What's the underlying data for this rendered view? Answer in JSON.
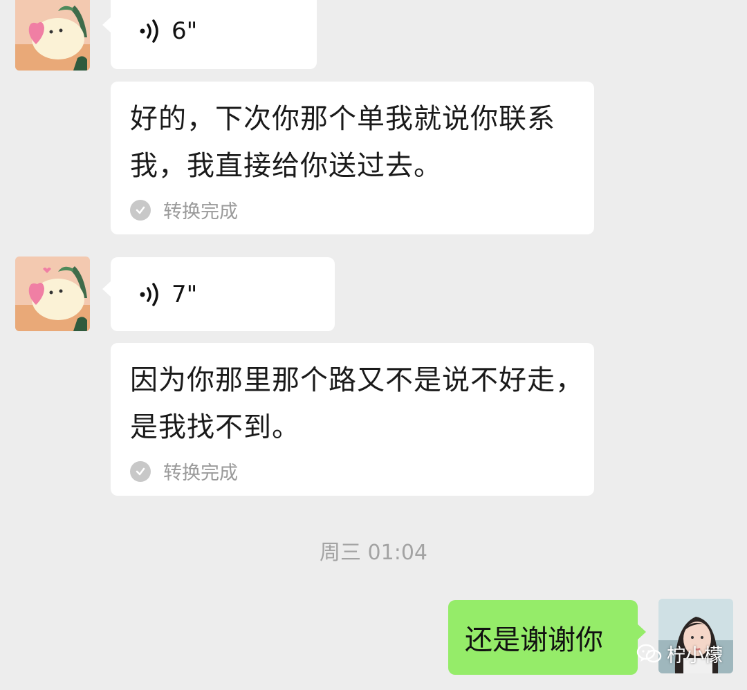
{
  "messages": [
    {
      "sender": "contact",
      "type": "voice",
      "duration": "6\""
    },
    {
      "sender": "contact",
      "type": "transcript",
      "text": "好的，下次你那个单我就说你联系我，我直接给你送过去。",
      "status": "转换完成"
    },
    {
      "sender": "contact",
      "type": "voice",
      "duration": "7\""
    },
    {
      "sender": "contact",
      "type": "transcript",
      "text": "因为你那里那个路又不是说不好走，是我找不到。",
      "status": "转换完成"
    }
  ],
  "timestamp": "周三 01:04",
  "outgoing": {
    "text": "还是谢谢你"
  },
  "watermark": "柠小檬",
  "colors": {
    "background": "#ededed",
    "bubble_incoming": "#ffffff",
    "bubble_outgoing": "#95ec69",
    "status_text": "#9a9a9a"
  },
  "icons": {
    "voice": "voice-wave-icon",
    "status": "check-circle-icon",
    "watermark": "wechat-logo-icon"
  }
}
